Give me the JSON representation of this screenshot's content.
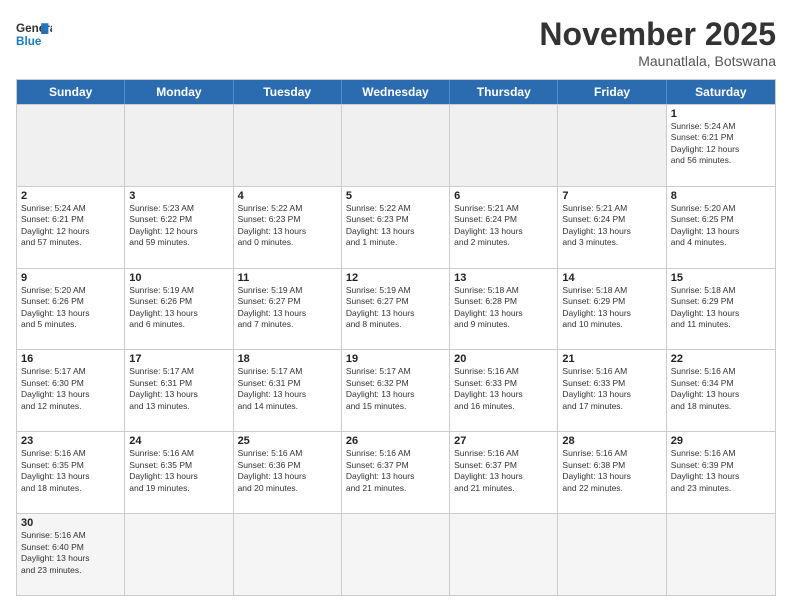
{
  "header": {
    "logo_general": "General",
    "logo_blue": "Blue",
    "month_title": "November 2025",
    "subtitle": "Maunatlala, Botswana"
  },
  "weekdays": [
    "Sunday",
    "Monday",
    "Tuesday",
    "Wednesday",
    "Thursday",
    "Friday",
    "Saturday"
  ],
  "rows": [
    [
      {
        "day": "",
        "info": ""
      },
      {
        "day": "",
        "info": ""
      },
      {
        "day": "",
        "info": ""
      },
      {
        "day": "",
        "info": ""
      },
      {
        "day": "",
        "info": ""
      },
      {
        "day": "",
        "info": ""
      },
      {
        "day": "1",
        "info": "Sunrise: 5:24 AM\nSunset: 6:21 PM\nDaylight: 12 hours\nand 56 minutes."
      }
    ],
    [
      {
        "day": "2",
        "info": "Sunrise: 5:24 AM\nSunset: 6:21 PM\nDaylight: 12 hours\nand 57 minutes."
      },
      {
        "day": "3",
        "info": "Sunrise: 5:23 AM\nSunset: 6:22 PM\nDaylight: 12 hours\nand 59 minutes."
      },
      {
        "day": "4",
        "info": "Sunrise: 5:22 AM\nSunset: 6:23 PM\nDaylight: 13 hours\nand 0 minutes."
      },
      {
        "day": "5",
        "info": "Sunrise: 5:22 AM\nSunset: 6:23 PM\nDaylight: 13 hours\nand 1 minute."
      },
      {
        "day": "6",
        "info": "Sunrise: 5:21 AM\nSunset: 6:24 PM\nDaylight: 13 hours\nand 2 minutes."
      },
      {
        "day": "7",
        "info": "Sunrise: 5:21 AM\nSunset: 6:24 PM\nDaylight: 13 hours\nand 3 minutes."
      },
      {
        "day": "8",
        "info": "Sunrise: 5:20 AM\nSunset: 6:25 PM\nDaylight: 13 hours\nand 4 minutes."
      }
    ],
    [
      {
        "day": "9",
        "info": "Sunrise: 5:20 AM\nSunset: 6:26 PM\nDaylight: 13 hours\nand 5 minutes."
      },
      {
        "day": "10",
        "info": "Sunrise: 5:19 AM\nSunset: 6:26 PM\nDaylight: 13 hours\nand 6 minutes."
      },
      {
        "day": "11",
        "info": "Sunrise: 5:19 AM\nSunset: 6:27 PM\nDaylight: 13 hours\nand 7 minutes."
      },
      {
        "day": "12",
        "info": "Sunrise: 5:19 AM\nSunset: 6:27 PM\nDaylight: 13 hours\nand 8 minutes."
      },
      {
        "day": "13",
        "info": "Sunrise: 5:18 AM\nSunset: 6:28 PM\nDaylight: 13 hours\nand 9 minutes."
      },
      {
        "day": "14",
        "info": "Sunrise: 5:18 AM\nSunset: 6:29 PM\nDaylight: 13 hours\nand 10 minutes."
      },
      {
        "day": "15",
        "info": "Sunrise: 5:18 AM\nSunset: 6:29 PM\nDaylight: 13 hours\nand 11 minutes."
      }
    ],
    [
      {
        "day": "16",
        "info": "Sunrise: 5:17 AM\nSunset: 6:30 PM\nDaylight: 13 hours\nand 12 minutes."
      },
      {
        "day": "17",
        "info": "Sunrise: 5:17 AM\nSunset: 6:31 PM\nDaylight: 13 hours\nand 13 minutes."
      },
      {
        "day": "18",
        "info": "Sunrise: 5:17 AM\nSunset: 6:31 PM\nDaylight: 13 hours\nand 14 minutes."
      },
      {
        "day": "19",
        "info": "Sunrise: 5:17 AM\nSunset: 6:32 PM\nDaylight: 13 hours\nand 15 minutes."
      },
      {
        "day": "20",
        "info": "Sunrise: 5:16 AM\nSunset: 6:33 PM\nDaylight: 13 hours\nand 16 minutes."
      },
      {
        "day": "21",
        "info": "Sunrise: 5:16 AM\nSunset: 6:33 PM\nDaylight: 13 hours\nand 17 minutes."
      },
      {
        "day": "22",
        "info": "Sunrise: 5:16 AM\nSunset: 6:34 PM\nDaylight: 13 hours\nand 18 minutes."
      }
    ],
    [
      {
        "day": "23",
        "info": "Sunrise: 5:16 AM\nSunset: 6:35 PM\nDaylight: 13 hours\nand 18 minutes."
      },
      {
        "day": "24",
        "info": "Sunrise: 5:16 AM\nSunset: 6:35 PM\nDaylight: 13 hours\nand 19 minutes."
      },
      {
        "day": "25",
        "info": "Sunrise: 5:16 AM\nSunset: 6:36 PM\nDaylight: 13 hours\nand 20 minutes."
      },
      {
        "day": "26",
        "info": "Sunrise: 5:16 AM\nSunset: 6:37 PM\nDaylight: 13 hours\nand 21 minutes."
      },
      {
        "day": "27",
        "info": "Sunrise: 5:16 AM\nSunset: 6:37 PM\nDaylight: 13 hours\nand 21 minutes."
      },
      {
        "day": "28",
        "info": "Sunrise: 5:16 AM\nSunset: 6:38 PM\nDaylight: 13 hours\nand 22 minutes."
      },
      {
        "day": "29",
        "info": "Sunrise: 5:16 AM\nSunset: 6:39 PM\nDaylight: 13 hours\nand 23 minutes."
      }
    ],
    [
      {
        "day": "30",
        "info": "Sunrise: 5:16 AM\nSunset: 6:40 PM\nDaylight: 13 hours\nand 23 minutes."
      },
      {
        "day": "",
        "info": ""
      },
      {
        "day": "",
        "info": ""
      },
      {
        "day": "",
        "info": ""
      },
      {
        "day": "",
        "info": ""
      },
      {
        "day": "",
        "info": ""
      },
      {
        "day": "",
        "info": ""
      }
    ]
  ]
}
